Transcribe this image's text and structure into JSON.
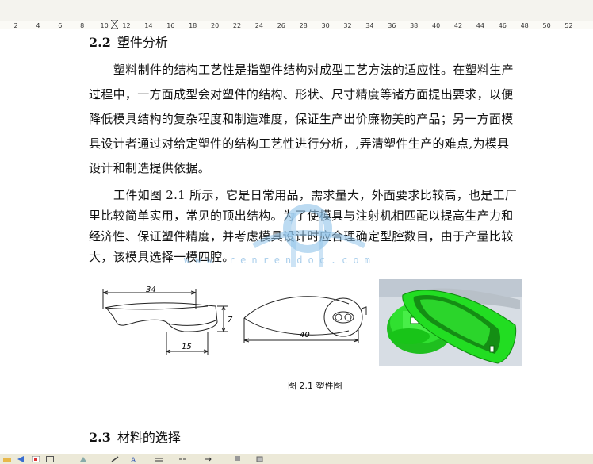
{
  "ruler": {
    "numbers": [
      "2",
      "4",
      "6",
      "8",
      "10",
      "12",
      "14",
      "16",
      "18",
      "20",
      "22",
      "24",
      "26",
      "28",
      "30",
      "32",
      "34",
      "36",
      "38",
      "40",
      "42",
      "44",
      "46",
      "48",
      "50",
      "52"
    ]
  },
  "doc": {
    "section_22_number": "2.2",
    "section_22_title": "塑件分析",
    "para1": [
      "塑料制件的结构工艺性是指塑件结构对成型工艺方法的适应性。在塑料生产",
      "过程中，一方面成型会对塑件的结构、形状、尺寸精度等诸方面提出要求，以便",
      "降低模具结构的复杂程度和制造难度，保证生产出价廉物美的产品；另一方面模",
      "具设计者通过对给定塑件的结构工艺性进行分析，,弄清塑件生产的难点,为模具",
      "设计和制造提供依据。"
    ],
    "para2": [
      "工件如图  2.1  所示，它是日常用品，需求量大，外面要求比较高，也是工厂",
      "里比较简单实用，常见的顶出结构。为了使模具与注射机相匹配以提高生产力和",
      "经济性、保证塑件精度，并考虑模具设计时应合理确定型腔数目，由于产量比较",
      "大，该模具选择一模四腔。"
    ],
    "watermark": "www.renrendoc.com",
    "figure": {
      "dim_34": "34",
      "dim_7": "7",
      "dim_15": "15",
      "dim_40": "40",
      "caption": "图  2.1  塑件图"
    },
    "section_23_number": "2.3",
    "section_23_title": "材料的选择"
  },
  "colors": {
    "model_green": "#22dd22",
    "watermark_blue": "#9bc6e8",
    "ruler_bg": "#f4f3ee"
  }
}
